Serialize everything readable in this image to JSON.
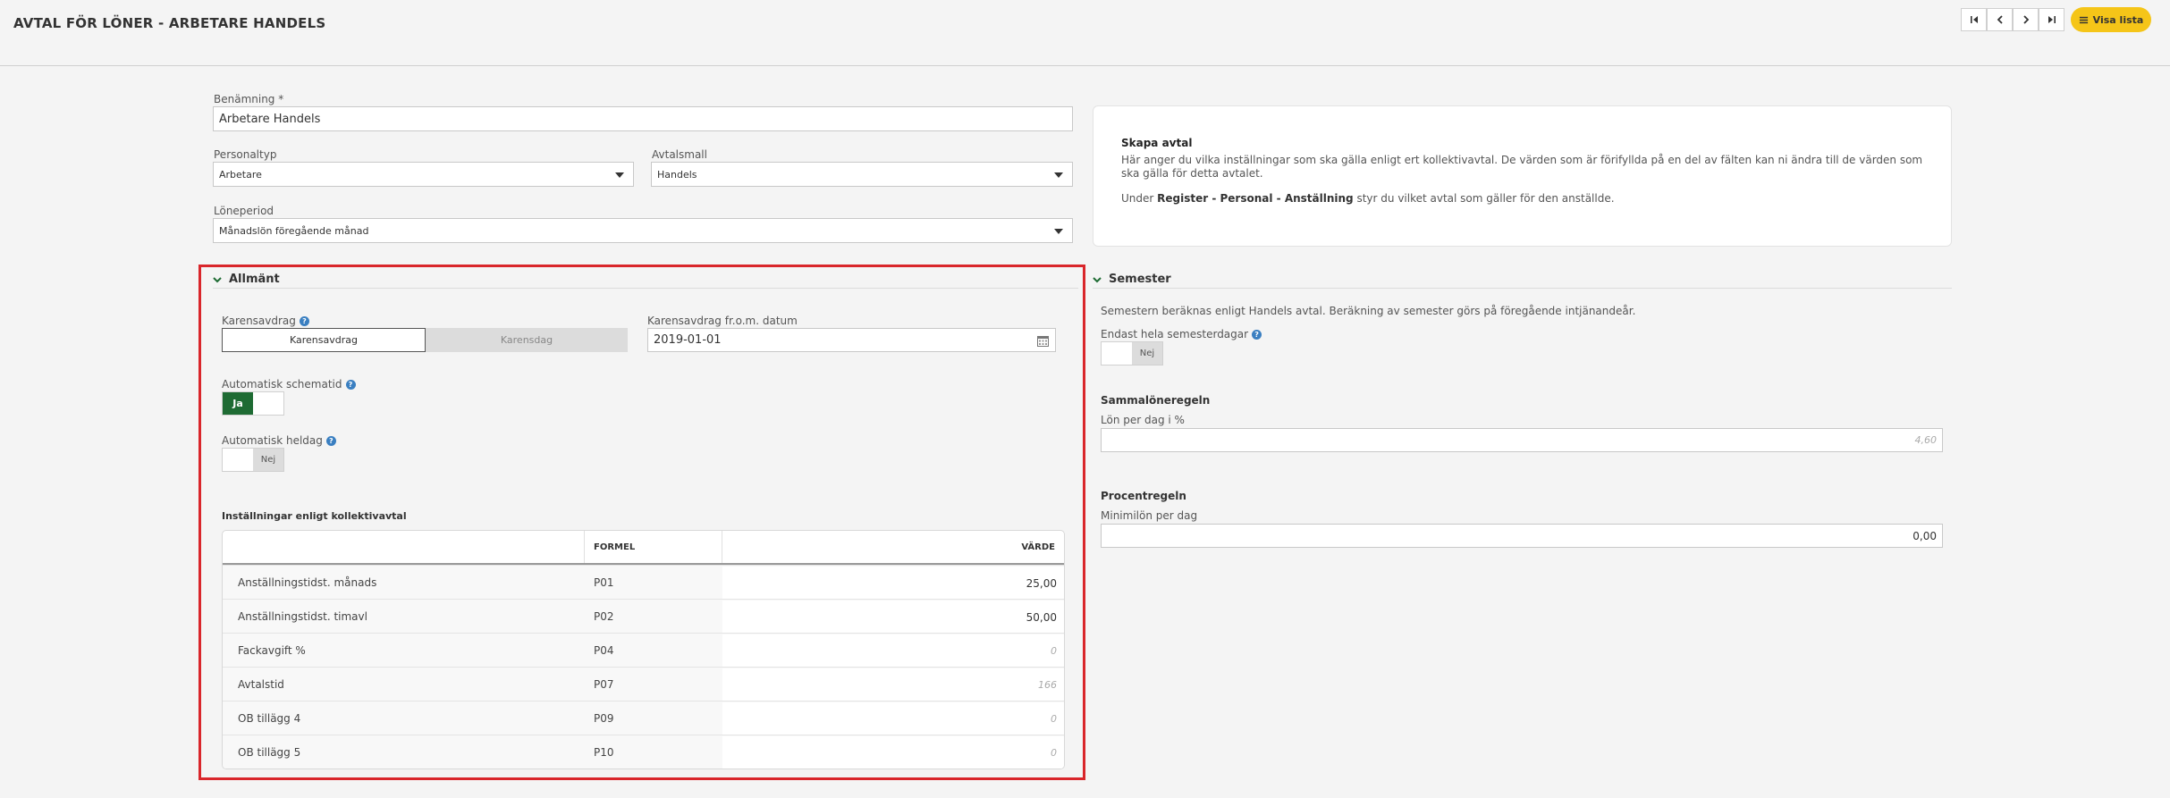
{
  "header": {
    "title": "AVTAL FÖR LÖNER - ARBETARE HANDELS",
    "visa_lista": "Visa lista"
  },
  "form": {
    "benamning_label": "Benämning *",
    "benamning_value": "Arbetare Handels",
    "personaltyp_label": "Personaltyp",
    "personaltyp_value": "Arbetare",
    "avtalsmall_label": "Avtalsmall",
    "avtalsmall_value": "Handels",
    "loneperiod_label": "Löneperiod",
    "loneperiod_value": "Månadslön föregående månad"
  },
  "info": {
    "title": "Skapa avtal",
    "text1": "Här anger du vilka inställningar som ska gälla enligt ert kollektivavtal. De värden som är förifyllda på en del av fälten kan ni ändra till de värden som ska gälla för detta avtalet.",
    "text2_pre": "Under ",
    "text2_bold": "Register - Personal - Anställning",
    "text2_post": " styr du vilket avtal som gäller för den anställde."
  },
  "allmant": {
    "title": "Allmänt",
    "karensavdrag_label": "Karensavdrag",
    "seg_on": "Karensavdrag",
    "seg_off": "Karensdag",
    "karens_datum_label": "Karensavdrag fr.o.m. datum",
    "karens_datum_value": "2019-01-01",
    "auto_schematid_label": "Automatisk schematid",
    "auto_schematid_value": "Ja",
    "auto_heldag_label": "Automatisk heldag",
    "auto_heldag_value": "Nej",
    "table_title": "Inställningar enligt kollektivavtal",
    "col_formel": "FORMEL",
    "col_varde": "VÄRDE",
    "rows": [
      {
        "name": "Anställningstidst. månads",
        "formel": "P01",
        "value": "25,00",
        "placeholder": false
      },
      {
        "name": "Anställningstidst. timavl",
        "formel": "P02",
        "value": "50,00",
        "placeholder": false
      },
      {
        "name": "Fackavgift %",
        "formel": "P04",
        "value": "0",
        "placeholder": true
      },
      {
        "name": "Avtalstid",
        "formel": "P07",
        "value": "166",
        "placeholder": true
      },
      {
        "name": "OB tillägg 4",
        "formel": "P09",
        "value": "0",
        "placeholder": true
      },
      {
        "name": "OB tillägg 5",
        "formel": "P10",
        "value": "0",
        "placeholder": true
      }
    ]
  },
  "semester": {
    "title": "Semester",
    "desc": "Semestern beräknas enligt Handels avtal. Beräkning av semester görs på föregående intjänandeår.",
    "hela_label": "Endast hela semesterdagar",
    "hela_value": "Nej",
    "sammalone_title": "Sammalöneregeln",
    "lon_per_dag_label": "Lön per dag i %",
    "lon_per_dag_value": "4,60",
    "procent_title": "Procentregeln",
    "minimilon_label": "Minimilön per dag",
    "minimilon_value": "0,00"
  }
}
